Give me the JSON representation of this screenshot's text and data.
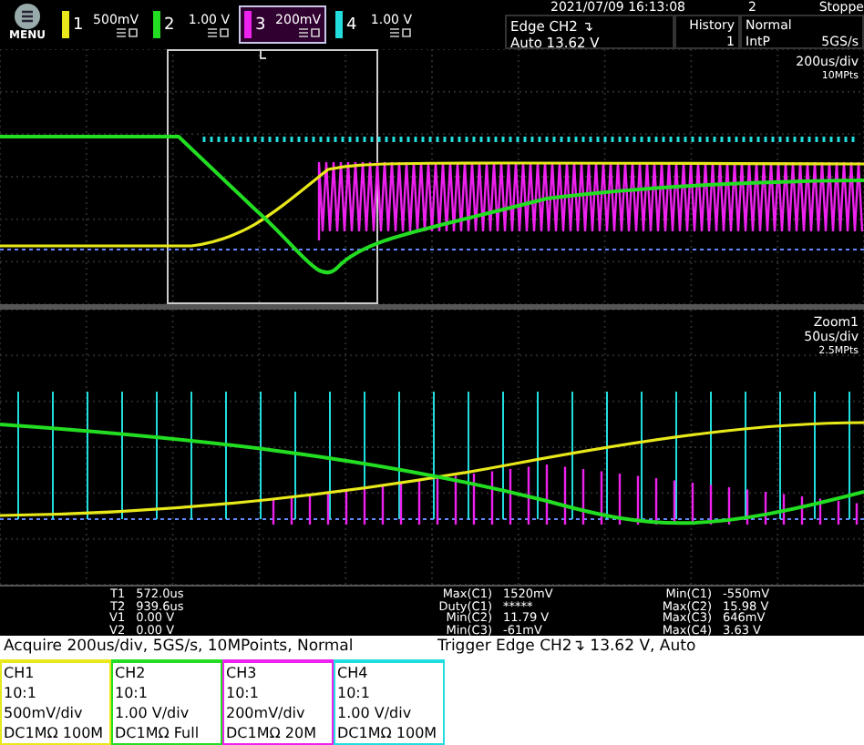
{
  "menu_button": {
    "label": "MENU"
  },
  "channels": [
    {
      "number": "1",
      "scale": "500mV",
      "color": "#e8e81a",
      "selected": false
    },
    {
      "number": "2",
      "scale": "1.00 V",
      "color": "#22dd22",
      "selected": false
    },
    {
      "number": "3",
      "scale": "200mV",
      "color": "#ee22ee",
      "selected": true
    },
    {
      "number": "4",
      "scale": "1.00 V",
      "color": "#22dddd",
      "selected": false
    }
  ],
  "trigger": {
    "line_1": "Edge CH2 ↴",
    "line_2": "Auto 13.62 V"
  },
  "history": {
    "label": "History",
    "count": "1"
  },
  "status": {
    "date": "2021/07/09 16:13:08",
    "number": "2",
    "state": "Stoppe"
  },
  "acquisition": {
    "mode": "Normal",
    "interpolation": "IntP",
    "rate": "5GS/s"
  },
  "main_plot": {
    "timebase": "200us/div",
    "points": "10MPts"
  },
  "zoom_plot": {
    "title": "Zoom1",
    "timebase": "50us/div",
    "points": "2.5MPts"
  },
  "measurements": {
    "cursors": [
      {
        "label": "T1",
        "value": "572.0us"
      },
      {
        "label": "T2",
        "value": "939.6us"
      },
      {
        "label": "V1",
        "value": "0.00 V"
      },
      {
        "label": "V2",
        "value": "0.00 V"
      }
    ],
    "column_2": [
      {
        "label": "Max(C1)",
        "value": "1520mV"
      },
      {
        "label": "Duty(C1)",
        "value": "*****"
      },
      {
        "label": "Min(C2)",
        "value": "11.79 V"
      },
      {
        "label": "Min(C3)",
        "value": "-61mV"
      }
    ],
    "column_3": [
      {
        "label": "Min(C1)",
        "value": "-550mV"
      },
      {
        "label": "Max(C2)",
        "value": "15.98 V"
      },
      {
        "label": "Max(C3)",
        "value": "646mV"
      },
      {
        "label": "Max(C4)",
        "value": "3.63 V"
      }
    ]
  },
  "status_bar": {
    "acquire": "Acquire 200us/div, 5GS/s, 10MPoints, Normal",
    "trigger": "Trigger Edge CH2↴ 13.62 V, Auto"
  },
  "channel_table": [
    {
      "name": "CH1",
      "probe": "10:1",
      "scale": "500mV/div",
      "coupling": "DC1MΩ 100M",
      "color": "#e8e81a"
    },
    {
      "name": "CH2",
      "probe": "10:1",
      "scale": "1.00 V/div",
      "coupling": "DC1MΩ Full",
      "color": "#22dd22"
    },
    {
      "name": "CH3",
      "probe": "10:1",
      "scale": "200mV/div",
      "coupling": "DC1MΩ 20M",
      "color": "#ee22ee"
    },
    {
      "name": "CH4",
      "probe": "10:1",
      "scale": "1.00 V/div",
      "coupling": "DC1MΩ 100M",
      "color": "#22dddd"
    }
  ]
}
